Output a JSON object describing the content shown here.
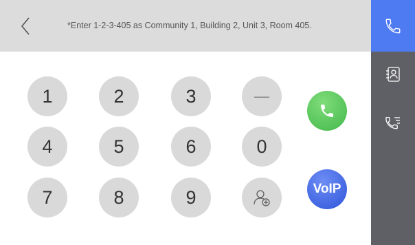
{
  "header": {
    "back_icon": "chevron-left-icon",
    "hint": "*Enter 1-2-3-405 as Community 1, Building 2, Unit 3, Room 405."
  },
  "keypad": {
    "keys": [
      "1",
      "2",
      "3",
      "—",
      "4",
      "5",
      "6",
      "0",
      "7",
      "8",
      "9"
    ],
    "contact_key_icon": "add-contact-icon"
  },
  "actions": {
    "call_icon": "phone-icon",
    "voip_label": "VoIP"
  },
  "sidebar": {
    "items": [
      {
        "icon": "phone-icon",
        "active": true
      },
      {
        "icon": "contacts-icon",
        "active": false
      },
      {
        "icon": "call-log-icon",
        "active": false
      }
    ]
  },
  "colors": {
    "accent": "#4f7bf2",
    "call_green": "#4cbb4f",
    "voip_blue": "#3a5fe0",
    "sidebar": "#5f5f66",
    "key": "#d9d9d9",
    "topbar": "#dcdcdc"
  }
}
